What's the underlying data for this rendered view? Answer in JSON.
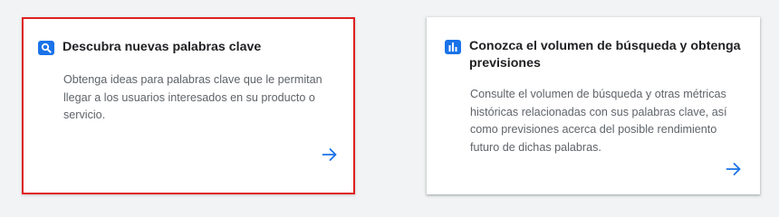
{
  "cards": [
    {
      "title": "Descubra nuevas palabras clave",
      "description": "Obtenga ideas para palabras clave que le permitan llegar a los usuarios interesados en su producto o servicio.",
      "icon": "search-icon"
    },
    {
      "title": "Conozca el volumen de búsqueda y obtenga previsiones",
      "description": "Consulte el volumen de búsqueda y otras métricas históricas relacionadas con sus palabras clave, así como previsiones acerca del posible rendimiento futuro de dichas palabras.",
      "icon": "bar-chart-icon"
    }
  ],
  "colors": {
    "accent": "#1a73e8",
    "selected_border": "#e02020",
    "background": "#f1f3f4"
  },
  "arrow_icon": "arrow-right-icon"
}
